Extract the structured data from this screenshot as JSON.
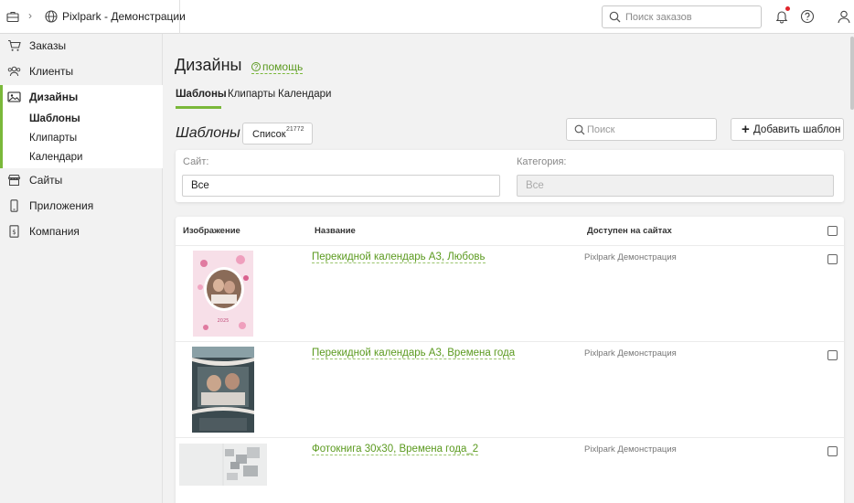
{
  "header": {
    "company": "Pixlpark - Демонстрации",
    "search_placeholder": "Поиск заказов"
  },
  "sidebar": {
    "items": [
      {
        "label": "Заказы",
        "icon": "cart-icon"
      },
      {
        "label": "Клиенты",
        "icon": "users-icon"
      },
      {
        "label": "Дизайны",
        "icon": "image-icon"
      },
      {
        "label": "Сайты",
        "icon": "store-icon"
      },
      {
        "label": "Приложения",
        "icon": "phone-icon"
      },
      {
        "label": "Компания",
        "icon": "document-icon"
      }
    ],
    "sub_items": [
      "Шаблоны",
      "Клипарты",
      "Календари"
    ]
  },
  "page": {
    "title": "Дизайны",
    "help_label": "помощь",
    "tabs": [
      "Шаблоны",
      "Клипарты",
      "Календари"
    ],
    "section_title": "Шаблоны",
    "list_button": {
      "label": "Список",
      "count": "21772"
    },
    "search_placeholder": "Поиск",
    "add_button": "Добавить шаблон"
  },
  "filters": {
    "site_label": "Сайт:",
    "site_value": "Все",
    "category_label": "Категория:",
    "category_value": "Все"
  },
  "table": {
    "columns": [
      "Изображение",
      "Название",
      "Доступен на сайтах"
    ],
    "rows": [
      {
        "name": "Перекидной календарь А3, Любовь",
        "site": "Pixlpark Демонстрация"
      },
      {
        "name": "Перекидной календарь А3, Времена года",
        "site": "Pixlpark Демонстрация"
      },
      {
        "name": "Фотокнига 30х30, Времена года_2",
        "site": "Pixlpark Демонстрация"
      }
    ]
  },
  "colors": {
    "accent": "#7ab83a",
    "link": "#5b9a1f",
    "notification": "#e0242b"
  }
}
